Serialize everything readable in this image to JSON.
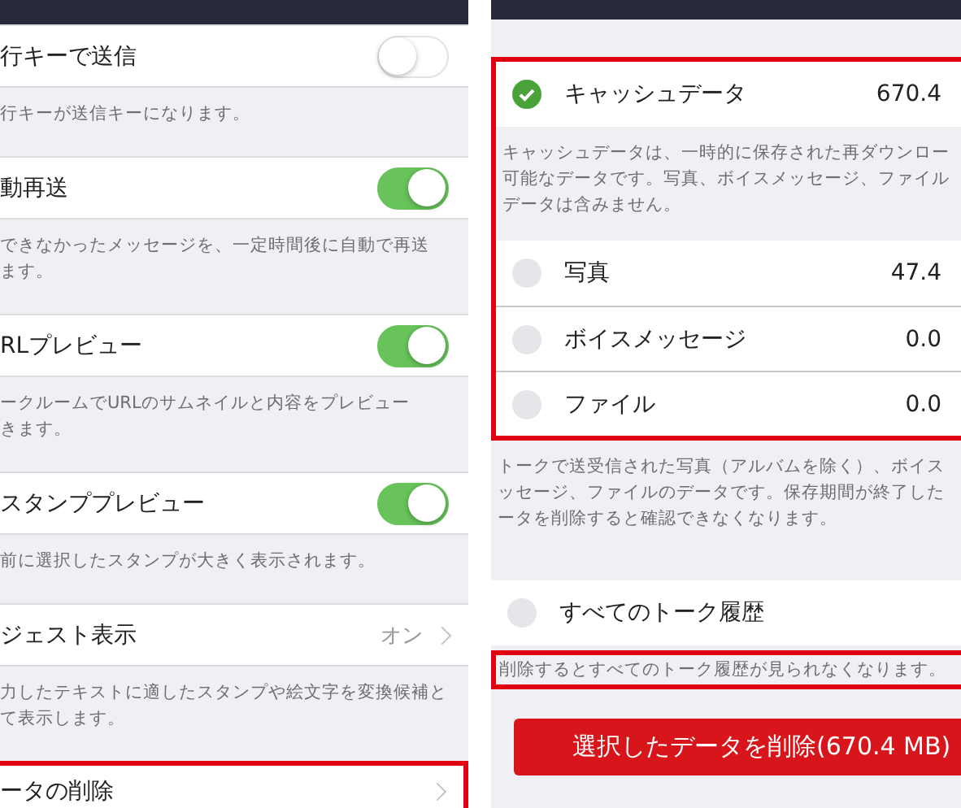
{
  "left_screen": {
    "settings": [
      {
        "label": "行キーで送信",
        "kind": "toggle",
        "on": false,
        "description": [
          "行キーが送信キーになります。"
        ]
      },
      {
        "label": "動再送",
        "kind": "toggle",
        "on": true,
        "description": [
          "できなかったメッセージを、一定時間後に自動で再送",
          "ます。"
        ]
      },
      {
        "label": "RLプレビュー",
        "kind": "toggle",
        "on": true,
        "description": [
          "ークルームでURLのサムネイルと内容をプレビュー",
          "きます。"
        ]
      },
      {
        "label": "スタンププレビュー",
        "kind": "toggle",
        "on": true,
        "description": [
          "前に選択したスタンプが大きく表示されます。"
        ]
      },
      {
        "label": "ジェスト表示",
        "kind": "value",
        "value": "オン",
        "description": [
          "力したテキストに適したスタンプや絵文字を変換候補と",
          "て表示します。"
        ]
      },
      {
        "label": "ータの削除",
        "kind": "link",
        "highlighted": true
      }
    ]
  },
  "right_screen": {
    "data_group": {
      "highlighted": true,
      "items": [
        {
          "label": "キャッシュデータ",
          "size": "670.4",
          "checked": true,
          "description": [
            "キャッシュデータは、一時的に保存された再ダウンロー",
            "可能なデータです。写真、ボイスメッセージ、ファイル",
            "データは含みません。"
          ]
        },
        {
          "label": "写真",
          "size": "47.4",
          "checked": false
        },
        {
          "label": "ボイスメッセージ",
          "size": "0.0",
          "checked": false
        },
        {
          "label": "ファイル",
          "size": "0.0",
          "checked": false
        }
      ]
    },
    "group_note": [
      "トークで送受信された写真（アルバムを除く）、ボイス",
      "ッセージ、ファイルのデータです。保存期間が終了した",
      "ータを削除すると確認できなくなります。"
    ],
    "history": {
      "label": "すべてのトーク履歴",
      "checked": false,
      "note": "削除するとすべてのトーク履歴が見られなくなります。",
      "note_highlighted": true
    },
    "delete_button": "選択したデータを削除(670.4 MB)"
  }
}
